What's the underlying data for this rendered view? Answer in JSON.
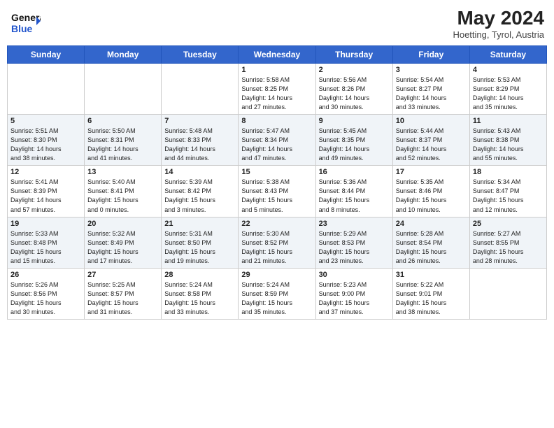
{
  "header": {
    "logo_line1": "General",
    "logo_line2": "Blue",
    "month_year": "May 2024",
    "location": "Hoetting, Tyrol, Austria"
  },
  "days_of_week": [
    "Sunday",
    "Monday",
    "Tuesday",
    "Wednesday",
    "Thursday",
    "Friday",
    "Saturday"
  ],
  "weeks": [
    [
      {
        "day": "",
        "info": ""
      },
      {
        "day": "",
        "info": ""
      },
      {
        "day": "",
        "info": ""
      },
      {
        "day": "1",
        "info": "Sunrise: 5:58 AM\nSunset: 8:25 PM\nDaylight: 14 hours\nand 27 minutes."
      },
      {
        "day": "2",
        "info": "Sunrise: 5:56 AM\nSunset: 8:26 PM\nDaylight: 14 hours\nand 30 minutes."
      },
      {
        "day": "3",
        "info": "Sunrise: 5:54 AM\nSunset: 8:27 PM\nDaylight: 14 hours\nand 33 minutes."
      },
      {
        "day": "4",
        "info": "Sunrise: 5:53 AM\nSunset: 8:29 PM\nDaylight: 14 hours\nand 35 minutes."
      }
    ],
    [
      {
        "day": "5",
        "info": "Sunrise: 5:51 AM\nSunset: 8:30 PM\nDaylight: 14 hours\nand 38 minutes."
      },
      {
        "day": "6",
        "info": "Sunrise: 5:50 AM\nSunset: 8:31 PM\nDaylight: 14 hours\nand 41 minutes."
      },
      {
        "day": "7",
        "info": "Sunrise: 5:48 AM\nSunset: 8:33 PM\nDaylight: 14 hours\nand 44 minutes."
      },
      {
        "day": "8",
        "info": "Sunrise: 5:47 AM\nSunset: 8:34 PM\nDaylight: 14 hours\nand 47 minutes."
      },
      {
        "day": "9",
        "info": "Sunrise: 5:45 AM\nSunset: 8:35 PM\nDaylight: 14 hours\nand 49 minutes."
      },
      {
        "day": "10",
        "info": "Sunrise: 5:44 AM\nSunset: 8:37 PM\nDaylight: 14 hours\nand 52 minutes."
      },
      {
        "day": "11",
        "info": "Sunrise: 5:43 AM\nSunset: 8:38 PM\nDaylight: 14 hours\nand 55 minutes."
      }
    ],
    [
      {
        "day": "12",
        "info": "Sunrise: 5:41 AM\nSunset: 8:39 PM\nDaylight: 14 hours\nand 57 minutes."
      },
      {
        "day": "13",
        "info": "Sunrise: 5:40 AM\nSunset: 8:41 PM\nDaylight: 15 hours\nand 0 minutes."
      },
      {
        "day": "14",
        "info": "Sunrise: 5:39 AM\nSunset: 8:42 PM\nDaylight: 15 hours\nand 3 minutes."
      },
      {
        "day": "15",
        "info": "Sunrise: 5:38 AM\nSunset: 8:43 PM\nDaylight: 15 hours\nand 5 minutes."
      },
      {
        "day": "16",
        "info": "Sunrise: 5:36 AM\nSunset: 8:44 PM\nDaylight: 15 hours\nand 8 minutes."
      },
      {
        "day": "17",
        "info": "Sunrise: 5:35 AM\nSunset: 8:46 PM\nDaylight: 15 hours\nand 10 minutes."
      },
      {
        "day": "18",
        "info": "Sunrise: 5:34 AM\nSunset: 8:47 PM\nDaylight: 15 hours\nand 12 minutes."
      }
    ],
    [
      {
        "day": "19",
        "info": "Sunrise: 5:33 AM\nSunset: 8:48 PM\nDaylight: 15 hours\nand 15 minutes."
      },
      {
        "day": "20",
        "info": "Sunrise: 5:32 AM\nSunset: 8:49 PM\nDaylight: 15 hours\nand 17 minutes."
      },
      {
        "day": "21",
        "info": "Sunrise: 5:31 AM\nSunset: 8:50 PM\nDaylight: 15 hours\nand 19 minutes."
      },
      {
        "day": "22",
        "info": "Sunrise: 5:30 AM\nSunset: 8:52 PM\nDaylight: 15 hours\nand 21 minutes."
      },
      {
        "day": "23",
        "info": "Sunrise: 5:29 AM\nSunset: 8:53 PM\nDaylight: 15 hours\nand 23 minutes."
      },
      {
        "day": "24",
        "info": "Sunrise: 5:28 AM\nSunset: 8:54 PM\nDaylight: 15 hours\nand 26 minutes."
      },
      {
        "day": "25",
        "info": "Sunrise: 5:27 AM\nSunset: 8:55 PM\nDaylight: 15 hours\nand 28 minutes."
      }
    ],
    [
      {
        "day": "26",
        "info": "Sunrise: 5:26 AM\nSunset: 8:56 PM\nDaylight: 15 hours\nand 30 minutes."
      },
      {
        "day": "27",
        "info": "Sunrise: 5:25 AM\nSunset: 8:57 PM\nDaylight: 15 hours\nand 31 minutes."
      },
      {
        "day": "28",
        "info": "Sunrise: 5:24 AM\nSunset: 8:58 PM\nDaylight: 15 hours\nand 33 minutes."
      },
      {
        "day": "29",
        "info": "Sunrise: 5:24 AM\nSunset: 8:59 PM\nDaylight: 15 hours\nand 35 minutes."
      },
      {
        "day": "30",
        "info": "Sunrise: 5:23 AM\nSunset: 9:00 PM\nDaylight: 15 hours\nand 37 minutes."
      },
      {
        "day": "31",
        "info": "Sunrise: 5:22 AM\nSunset: 9:01 PM\nDaylight: 15 hours\nand 38 minutes."
      },
      {
        "day": "",
        "info": ""
      }
    ]
  ]
}
